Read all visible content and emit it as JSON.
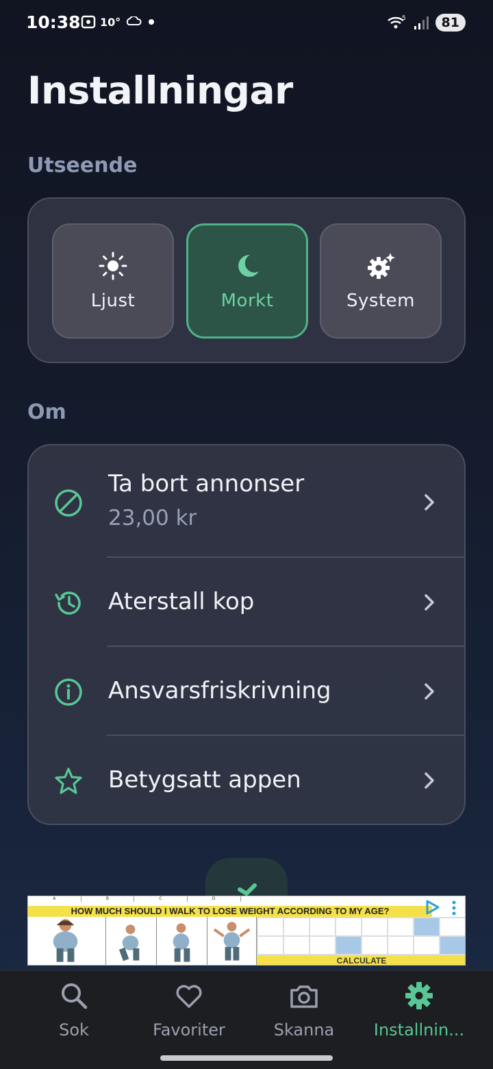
{
  "status": {
    "time": "10:38",
    "temperature": "10°",
    "battery": "81",
    "network": "5"
  },
  "page": {
    "title": "Installningar"
  },
  "appearance": {
    "label": "Utseende",
    "options": [
      {
        "label": "Ljust",
        "icon": "sun-icon",
        "active": false
      },
      {
        "label": "Morkt",
        "icon": "moon-icon",
        "active": true
      },
      {
        "label": "System",
        "icon": "gear-sparkle-icon",
        "active": false
      }
    ]
  },
  "about": {
    "label": "Om",
    "items": [
      {
        "title": "Ta bort annonser",
        "subtitle": "23,00 kr",
        "icon": "block-icon"
      },
      {
        "title": "Aterstall kop",
        "icon": "restore-icon"
      },
      {
        "title": "Ansvarsfriskrivning",
        "icon": "info-icon"
      },
      {
        "title": "Betygsatt appen",
        "icon": "star-icon"
      }
    ]
  },
  "ad": {
    "banner": "HOW MUCH SHOULD I WALK TO LOSE WEIGHT ACCORDING TO MY AGE?",
    "cta": "CALCULATE",
    "columns": [
      "A",
      "B",
      "C",
      "D"
    ]
  },
  "nav": {
    "items": [
      {
        "label": "Sok",
        "icon": "search-icon",
        "active": false
      },
      {
        "label": "Favoriter",
        "icon": "heart-icon",
        "active": false
      },
      {
        "label": "Skanna",
        "icon": "camera-icon",
        "active": false
      },
      {
        "label": "Installnin...",
        "icon": "settings-icon",
        "active": true
      }
    ]
  },
  "colors": {
    "accent": "#58c795",
    "background": "#141a2a",
    "card": "#343746"
  }
}
